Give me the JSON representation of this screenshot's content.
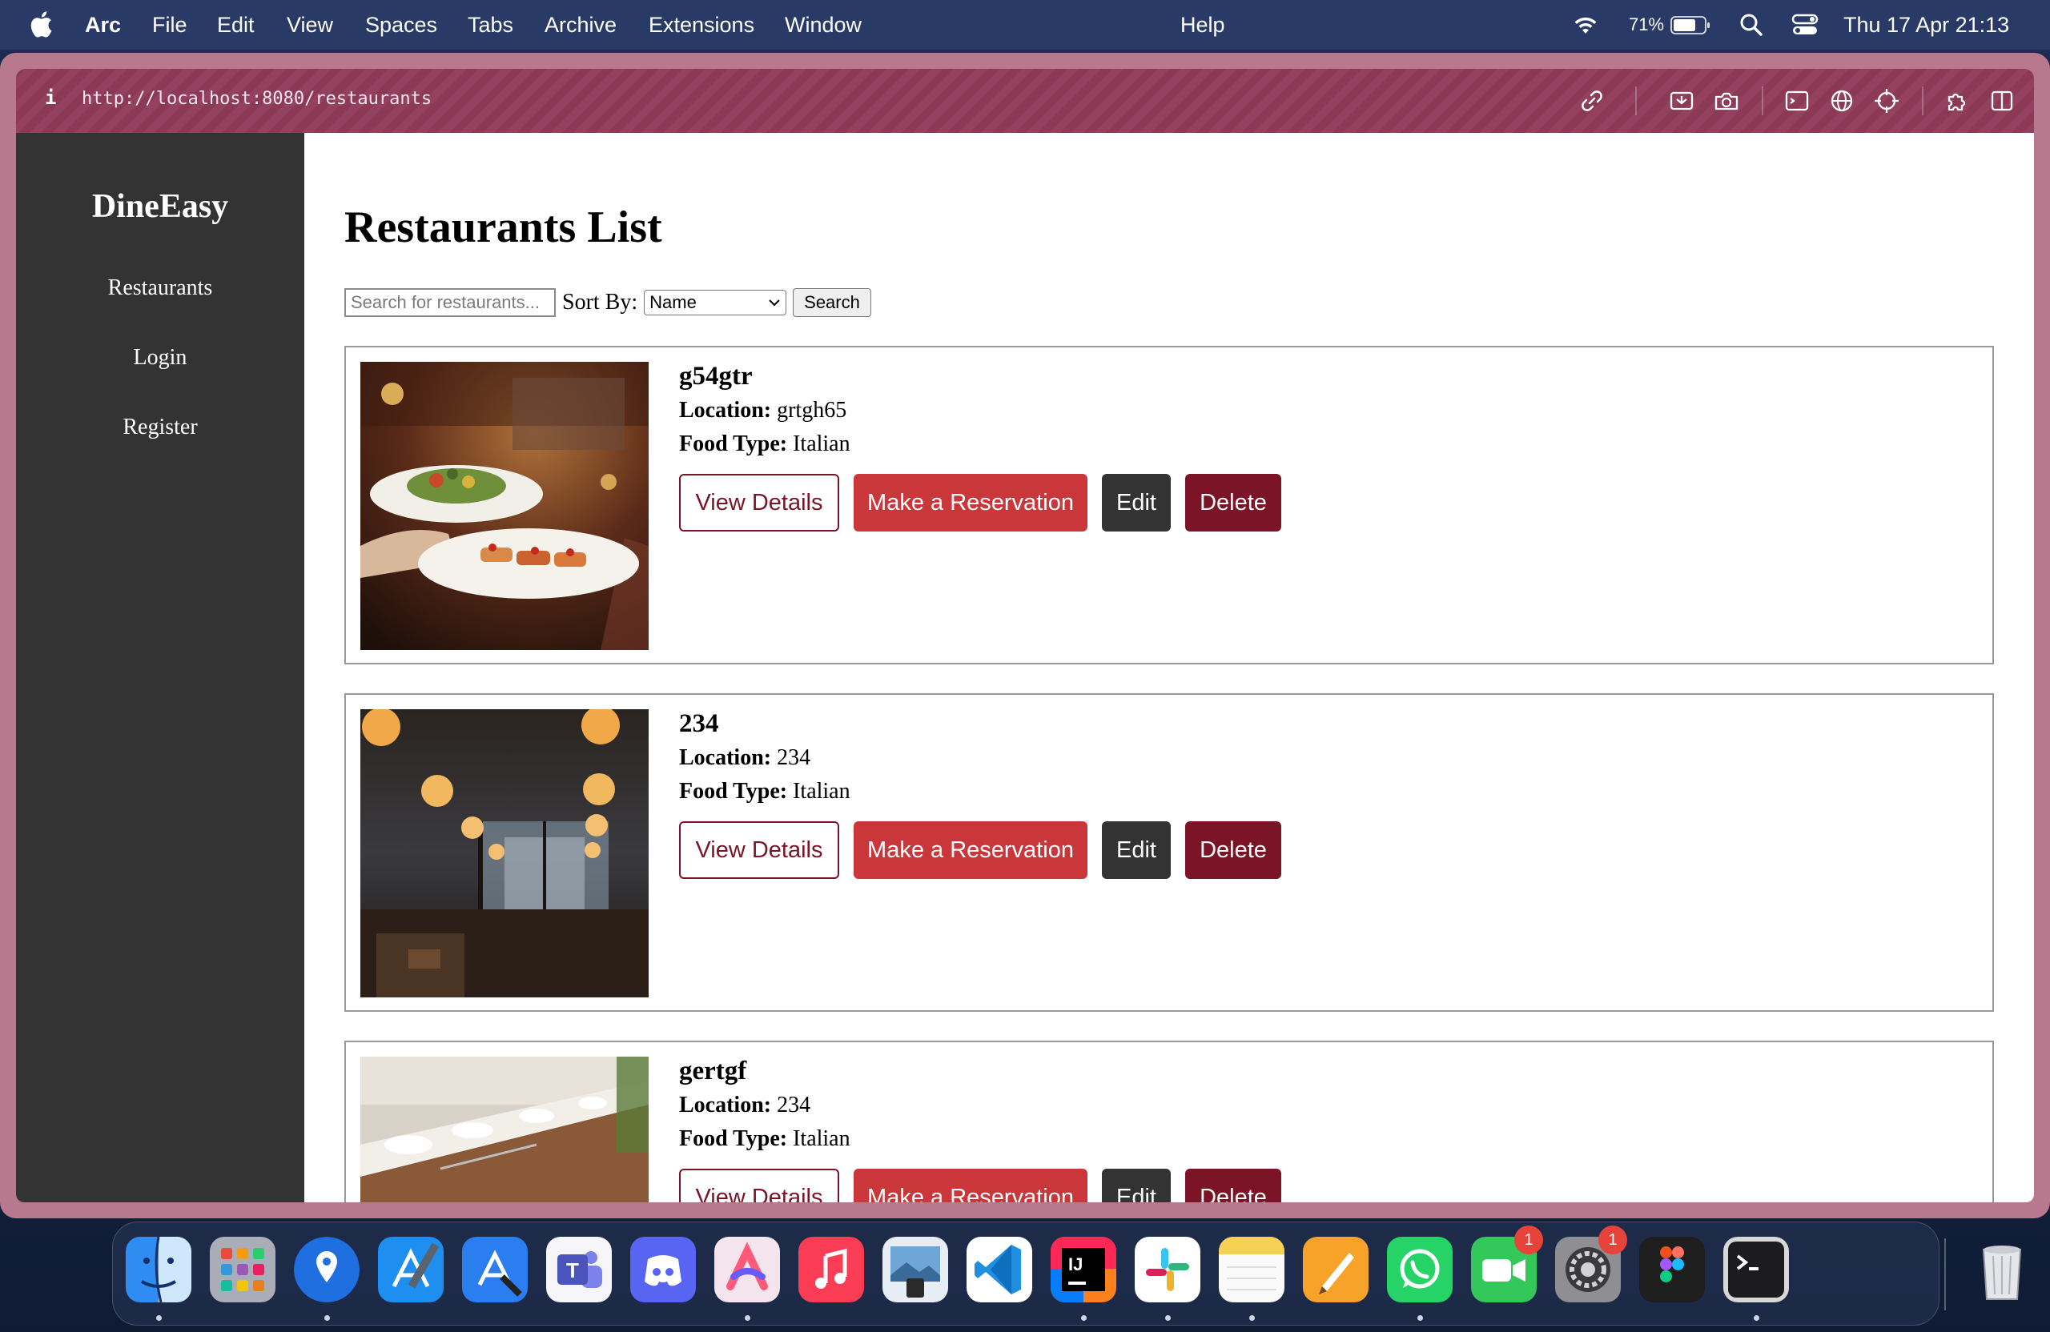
{
  "menubar": {
    "app_name": "Arc",
    "menus": [
      "File",
      "Edit",
      "View",
      "Spaces",
      "Tabs",
      "Archive",
      "Extensions",
      "Window"
    ],
    "help": "Help",
    "battery": "71%",
    "datetime": "Thu 17 Apr  21:13"
  },
  "browser": {
    "info_icon": "i",
    "url": "http://localhost:8080/restaurants"
  },
  "sidebar": {
    "brand": "DineEasy",
    "nav": [
      "Restaurants",
      "Login",
      "Register"
    ]
  },
  "page": {
    "title": "Restaurants List",
    "search_placeholder": "Search for restaurants...",
    "sort_label": "Sort By:",
    "sort_value": "Name",
    "search_button": "Search"
  },
  "labels": {
    "location": "Location:",
    "food_type": "Food Type:",
    "view_details": "View Details",
    "reserve": "Make a Reservation",
    "edit": "Edit",
    "delete": "Delete"
  },
  "restaurants": [
    {
      "name": "g54gtr",
      "location": "grtgh65",
      "food_type": "Italian",
      "image": "waiter-with-plates-photo"
    },
    {
      "name": "234",
      "location": "234",
      "food_type": "Italian",
      "image": "restaurant-interior-lamps-photo"
    },
    {
      "name": "gertgf",
      "location": "234",
      "food_type": "Italian",
      "image": "table-setting-photo"
    }
  ],
  "dock": {
    "apps": [
      "Finder",
      "Launchpad",
      "Maps Pin",
      "Xcode",
      "App Store Tools",
      "Teams",
      "Discord",
      "Arc",
      "Music",
      "Preview",
      "VS Code",
      "IntelliJ IDEA",
      "Slack",
      "Notes",
      "Pages",
      "WhatsApp",
      "FaceTime",
      "System Settings",
      "Figma",
      "Terminal",
      "Trash"
    ],
    "badges": {
      "facetime": "1",
      "settings": "1"
    }
  },
  "colors": {
    "sidebar_bg": "#333333",
    "url_bar": "#8f3a58",
    "reserve_button": "#c9373a",
    "delete_button": "#7a1426",
    "edit_button": "#333333"
  }
}
